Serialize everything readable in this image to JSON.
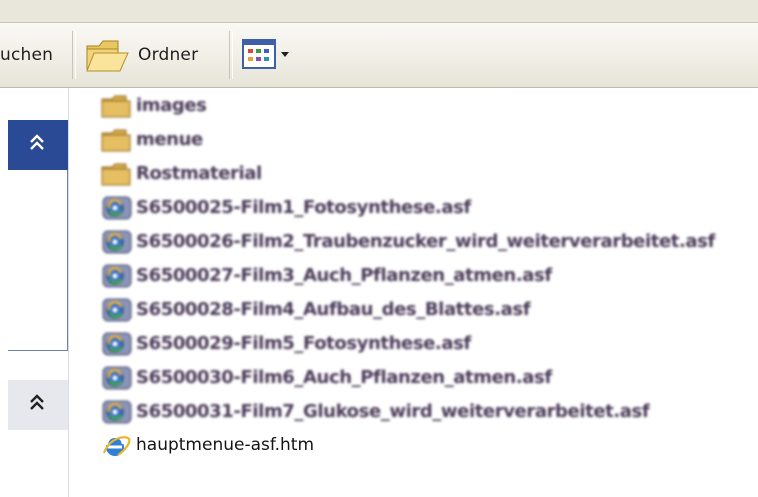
{
  "toolbar": {
    "search_label": "uchen",
    "folders_label": "Ordner"
  },
  "files": [
    {
      "name": "images",
      "type": "folder",
      "blurred": true
    },
    {
      "name": "menue",
      "type": "folder",
      "blurred": true
    },
    {
      "name": "Rostmaterial",
      "type": "folder",
      "blurred": true
    },
    {
      "name": "S6500025-Film1_Fotosynthese.asf",
      "type": "asf",
      "blurred": true
    },
    {
      "name": "S6500026-Film2_Traubenzucker_wird_weiterverarbeitet.asf",
      "type": "asf",
      "blurred": true
    },
    {
      "name": "S6500027-Film3_Auch_Pflanzen_atmen.asf",
      "type": "asf",
      "blurred": true
    },
    {
      "name": "S6500028-Film4_Aufbau_des_Blattes.asf",
      "type": "asf",
      "blurred": true
    },
    {
      "name": "S6500029-Film5_Fotosynthese.asf",
      "type": "asf",
      "blurred": true
    },
    {
      "name": "S6500030-Film6_Auch_Pflanzen_atmen.asf",
      "type": "asf",
      "blurred": true
    },
    {
      "name": "S6500031-Film7_Glukose_wird_weiterverarbeitet.asf",
      "type": "asf",
      "blurred": true
    },
    {
      "name": "hauptmenue-asf.htm",
      "type": "htm",
      "blurred": false
    }
  ],
  "colors": {
    "panel_header": "#2a4a96",
    "panel_header_light": "#e6e8ee",
    "toolbar_bg": "#efede4"
  }
}
